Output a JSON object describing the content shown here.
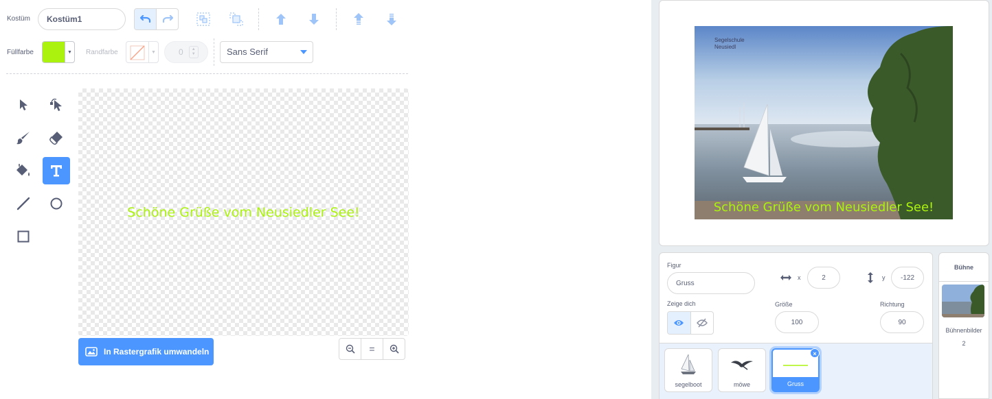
{
  "toolbar": {
    "costume_label": "Kostüm",
    "costume_name": "Kostüm1",
    "fill_label": "Füllfarbe",
    "stroke_label": "Randfarbe",
    "stroke_width": "0",
    "font": "Sans Serif",
    "fill_color": "#abf30e"
  },
  "canvas": {
    "text": "Schöne Grüße vom Neusiedler See!",
    "convert_button": "In Rastergrafik umwandeln",
    "zoom_reset_label": "="
  },
  "stage": {
    "caption": "Schöne Grüße vom Neusiedler See!",
    "logo_line1": "Segelschule",
    "logo_line2": "Neusiedl"
  },
  "sprite_info": {
    "sprite_label": "Figur",
    "sprite_name": "Gruss",
    "x_label": "x",
    "x_value": "2",
    "y_label": "y",
    "y_value": "-122",
    "show_label": "Zeige dich",
    "size_label": "Größe",
    "size_value": "100",
    "direction_label": "Richtung",
    "direction_value": "90"
  },
  "sprites": [
    {
      "name": "segelboot"
    },
    {
      "name": "möwe"
    },
    {
      "name": "Gruss"
    }
  ],
  "stage_panel": {
    "title": "Bühne",
    "backdrops_label": "Bühnenbilder",
    "backdrops_count": "2"
  },
  "colors": {
    "accent": "#4c97ff",
    "text": "#575e75",
    "fill": "#abf30e"
  }
}
